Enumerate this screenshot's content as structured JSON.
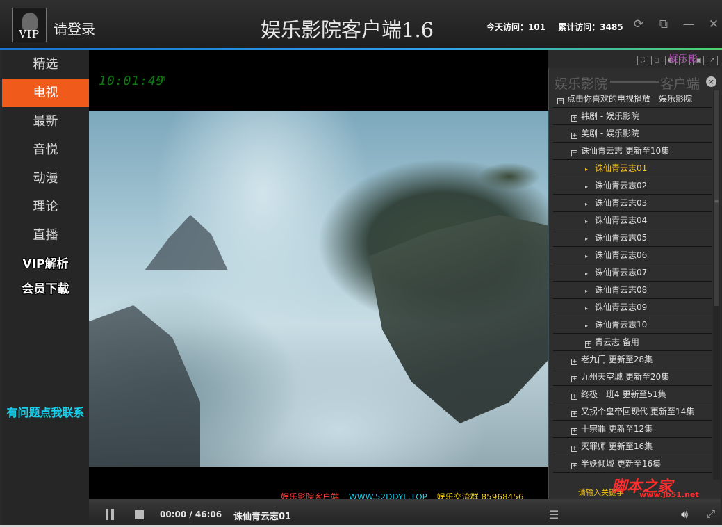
{
  "header": {
    "avatar_text": "VIP",
    "login_label": "请登录",
    "app_title": "娱乐影院客户端1.6",
    "today_visits": "今天访问：101",
    "total_visits": "累计访问：3485"
  },
  "sidebar": {
    "items": [
      {
        "label": "精选",
        "active": false
      },
      {
        "label": "电视",
        "active": true
      },
      {
        "label": "最新",
        "active": false
      },
      {
        "label": "音悦",
        "active": false
      },
      {
        "label": "动漫",
        "active": false
      },
      {
        "label": "理论",
        "active": false
      },
      {
        "label": "直播",
        "active": false
      }
    ],
    "vip_parse": "VIP解析",
    "member_download": "会员下载",
    "contact": "有问题点我联系"
  },
  "player": {
    "clock": "10:01:49",
    "clock_unit": "AM",
    "ticker_name": "娱乐影院客户端",
    "ticker_url": "WWW.52DDYL.TOP",
    "ticker_group": "娱乐交流群 85968456",
    "brand_mini": "娱乐影"
  },
  "playlist": {
    "header_left": "娱乐影院",
    "header_right": "客户端",
    "rows": [
      {
        "level": 0,
        "kind": "box",
        "sign": "−",
        "label": "点击你喜欢的电视播放 - 娱乐影院"
      },
      {
        "level": 1,
        "kind": "box",
        "sign": "+",
        "label": "韩剧 - 娱乐影院"
      },
      {
        "level": 1,
        "kind": "box",
        "sign": "+",
        "label": "美剧 - 娱乐影院"
      },
      {
        "level": 1,
        "kind": "box",
        "sign": "−",
        "label": "诛仙青云志 更新至10集"
      },
      {
        "level": 2,
        "kind": "arrow",
        "label": "诛仙青云志01",
        "current": true
      },
      {
        "level": 2,
        "kind": "arrow",
        "label": "诛仙青云志02"
      },
      {
        "level": 2,
        "kind": "arrow",
        "label": "诛仙青云志03"
      },
      {
        "level": 2,
        "kind": "arrow",
        "label": "诛仙青云志04"
      },
      {
        "level": 2,
        "kind": "arrow",
        "label": "诛仙青云志05"
      },
      {
        "level": 2,
        "kind": "arrow",
        "label": "诛仙青云志06"
      },
      {
        "level": 2,
        "kind": "arrow",
        "label": "诛仙青云志07"
      },
      {
        "level": 2,
        "kind": "arrow",
        "label": "诛仙青云志08"
      },
      {
        "level": 2,
        "kind": "arrow",
        "label": "诛仙青云志09"
      },
      {
        "level": 2,
        "kind": "arrow",
        "label": "诛仙青云志10"
      },
      {
        "level": 2,
        "kind": "box",
        "sign": "+",
        "label": "青云志 备用"
      },
      {
        "level": 1,
        "kind": "box",
        "sign": "+",
        "label": "老九门 更新至28集"
      },
      {
        "level": 1,
        "kind": "box",
        "sign": "+",
        "label": "九州天空城 更新至20集"
      },
      {
        "level": 1,
        "kind": "box",
        "sign": "+",
        "label": "终极一班4 更新至51集"
      },
      {
        "level": 1,
        "kind": "box",
        "sign": "+",
        "label": "又拐个皇帝回现代 更新至14集"
      },
      {
        "level": 1,
        "kind": "box",
        "sign": "+",
        "label": "十宗罪 更新至12集"
      },
      {
        "level": 1,
        "kind": "box",
        "sign": "+",
        "label": "灭罪师 更新至16集"
      },
      {
        "level": 1,
        "kind": "box",
        "sign": "+",
        "label": "半妖倾城 更新至16集"
      }
    ],
    "search_hint": "请输入关键字",
    "watermark": "脚本之家",
    "watermark_url": "www.jb51.net"
  },
  "controls": {
    "time": "00:00 / 46:06",
    "now_playing": "诛仙青云志01",
    "progress": 0
  },
  "colors": {
    "accent_orange": "#f05b1b",
    "contact_cyan": "#19d0ec",
    "current_yellow": "#f2c31c"
  }
}
